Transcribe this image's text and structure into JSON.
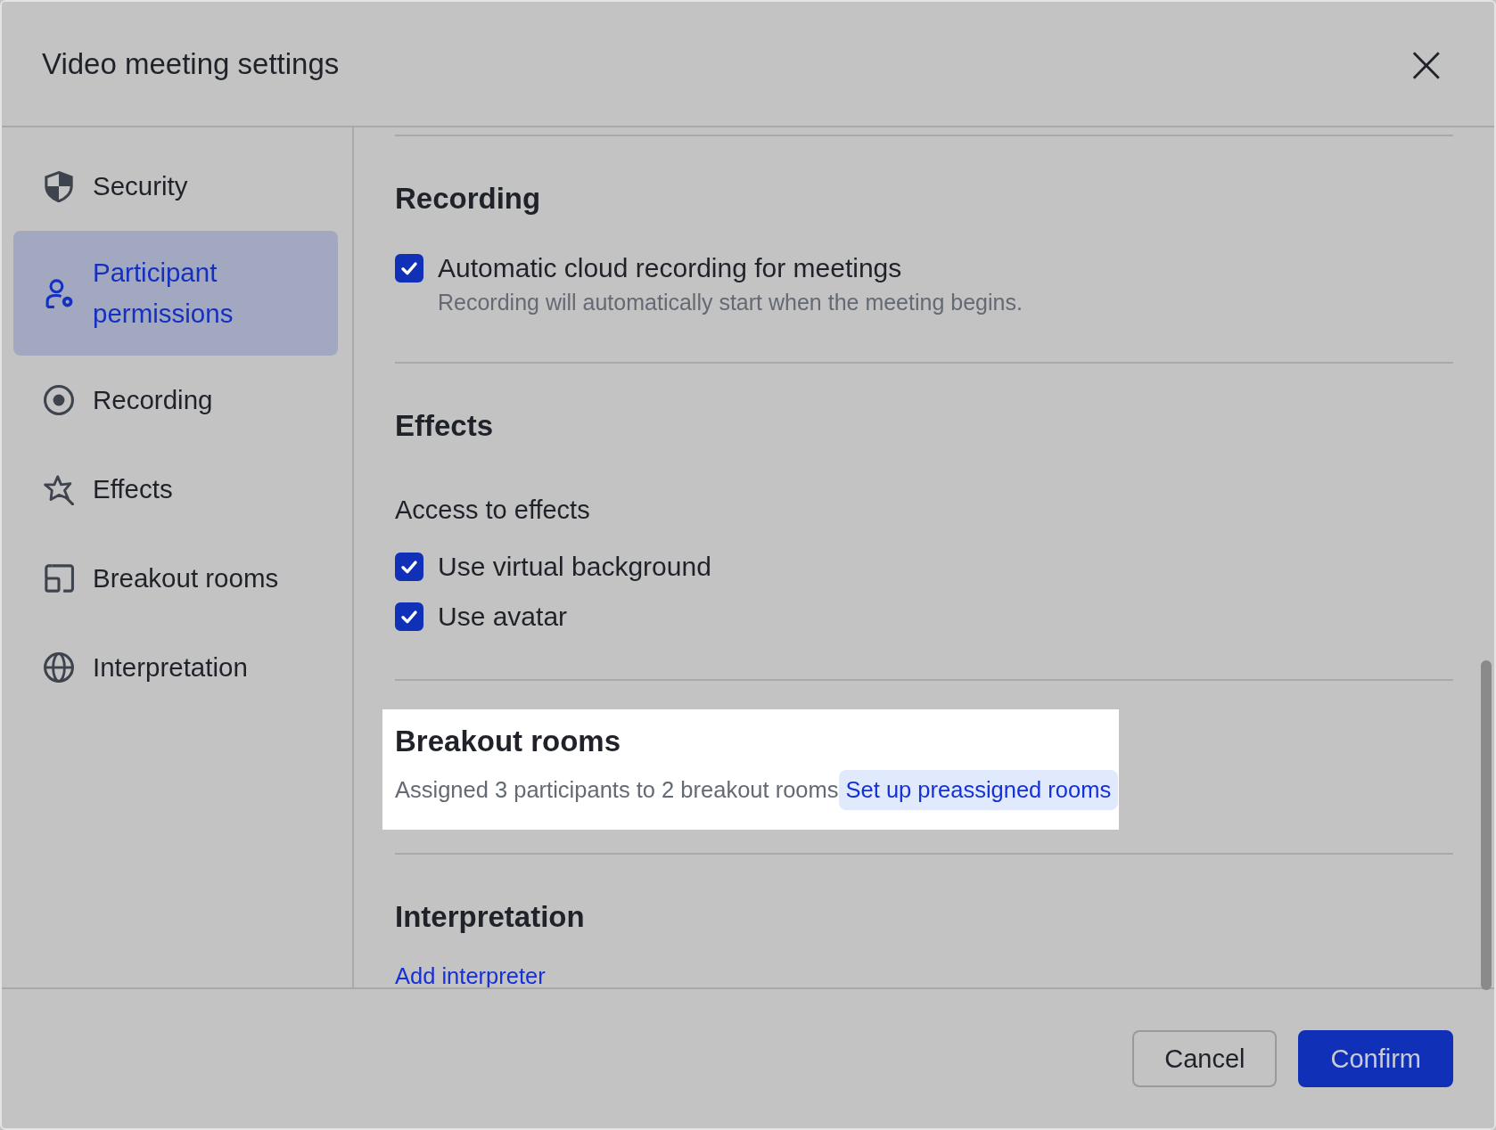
{
  "window": {
    "title": "Video meeting settings",
    "close": "×"
  },
  "sidebar": {
    "items": [
      {
        "label": "Security",
        "kind": "shield",
        "selected": false
      },
      {
        "label": "Participant permissions",
        "kind": "person",
        "selected": true
      },
      {
        "label": "Recording",
        "kind": "record",
        "selected": false
      },
      {
        "label": "Effects",
        "kind": "star",
        "selected": false
      },
      {
        "label": "Breakout rooms",
        "kind": "rooms",
        "selected": false
      },
      {
        "label": "Interpretation",
        "kind": "globe",
        "selected": false
      }
    ]
  },
  "sections": [
    {
      "title": "Recording",
      "highlighted": false,
      "options": [
        {
          "label": "Automatic cloud recording for meetings",
          "description": "Recording will automatically start when the meeting begins.",
          "checked": true
        }
      ]
    },
    {
      "title": "Effects",
      "subtitle": "Access to effects",
      "highlighted": false,
      "options": [
        {
          "label": "Use virtual background",
          "checked": true
        },
        {
          "label": "Use avatar",
          "checked": true
        }
      ]
    },
    {
      "title": "Breakout rooms",
      "highlighted": true,
      "note": "Assigned 3 participants to 2 breakout rooms",
      "link": "Set up preassigned rooms"
    },
    {
      "title": "Interpretation",
      "highlighted": false,
      "link": "Add interpreter"
    }
  ],
  "footer": {
    "buttons": [
      {
        "label": "Cancel",
        "kind": "secondary"
      },
      {
        "label": "Confirm",
        "kind": "primary"
      }
    ]
  }
}
